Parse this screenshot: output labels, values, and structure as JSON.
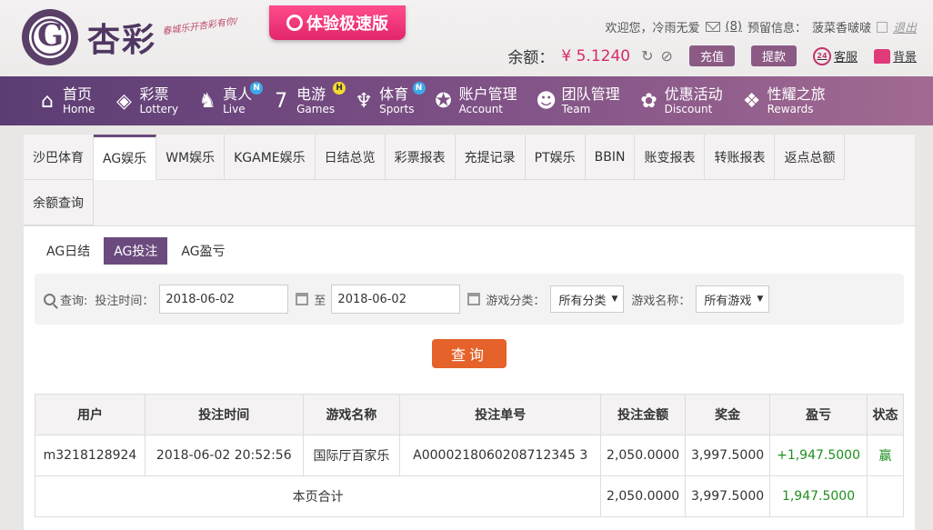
{
  "header": {
    "brand": "杏彩",
    "slogan": "春城乐开杏彩有你/",
    "promo": "体验极速版",
    "welcome": "欢迎您，冷雨无爱",
    "mail_count": "(8)",
    "reserved_label": "预留信息：",
    "reserved_value": "菠菜香啵啵",
    "logout": "退出",
    "balance_label": "余额：",
    "balance_value": "¥ 5.1240",
    "recharge": "充值",
    "withdraw": "提款",
    "service": "客服",
    "background": "背景",
    "service_badge": "24"
  },
  "nav": [
    {
      "cn": "首页",
      "en": "Home",
      "icon": "⌂"
    },
    {
      "cn": "彩票",
      "en": "Lottery",
      "icon": "◈"
    },
    {
      "cn": "真人",
      "en": "Live",
      "icon": "♞",
      "badge": "N"
    },
    {
      "cn": "电游",
      "en": "Games",
      "icon": "7",
      "badge": "H"
    },
    {
      "cn": "体育",
      "en": "Sports",
      "icon": "♆",
      "badge": "N"
    },
    {
      "cn": "账户管理",
      "en": "Account",
      "icon": "✪"
    },
    {
      "cn": "团队管理",
      "en": "Team",
      "icon": "☻"
    },
    {
      "cn": "优惠活动",
      "en": "Discount",
      "icon": "✿"
    },
    {
      "cn": "性耀之旅",
      "en": "Rewards",
      "icon": "❖"
    }
  ],
  "tabs": [
    "沙巴体育",
    "AG娱乐",
    "WM娱乐",
    "KGAME娱乐",
    "日结总览",
    "彩票报表",
    "充提记录",
    "PT娱乐",
    "BBIN",
    "账变报表",
    "转账报表",
    "返点总额",
    "余额查询"
  ],
  "subtabs": [
    "AG日结",
    "AG投注",
    "AG盈亏"
  ],
  "query": {
    "label": "查询:",
    "time_label": "投注时间：",
    "date_from": "2018-06-02",
    "to": "至",
    "date_to": "2018-06-02",
    "category_label": "游戏分类：",
    "category_value": "所有分类",
    "name_label": "游戏名称：",
    "name_value": "所有游戏",
    "button": "查询"
  },
  "table": {
    "headers": [
      "用户",
      "投注时间",
      "游戏名称",
      "投注单号",
      "投注金额",
      "奖金",
      "盈亏",
      "状态"
    ],
    "rows": [
      [
        "m3218128924",
        "2018-06-02 20:52:56",
        "国际厅百家乐",
        "A0000218060208712345 3",
        "2,050.0000",
        "3,997.5000",
        "+1,947.5000",
        "赢"
      ]
    ],
    "total_label": "本页合计",
    "total_amount": "2,050.0000",
    "total_bonus": "3,997.5000",
    "total_profit": "1,947.5000"
  }
}
